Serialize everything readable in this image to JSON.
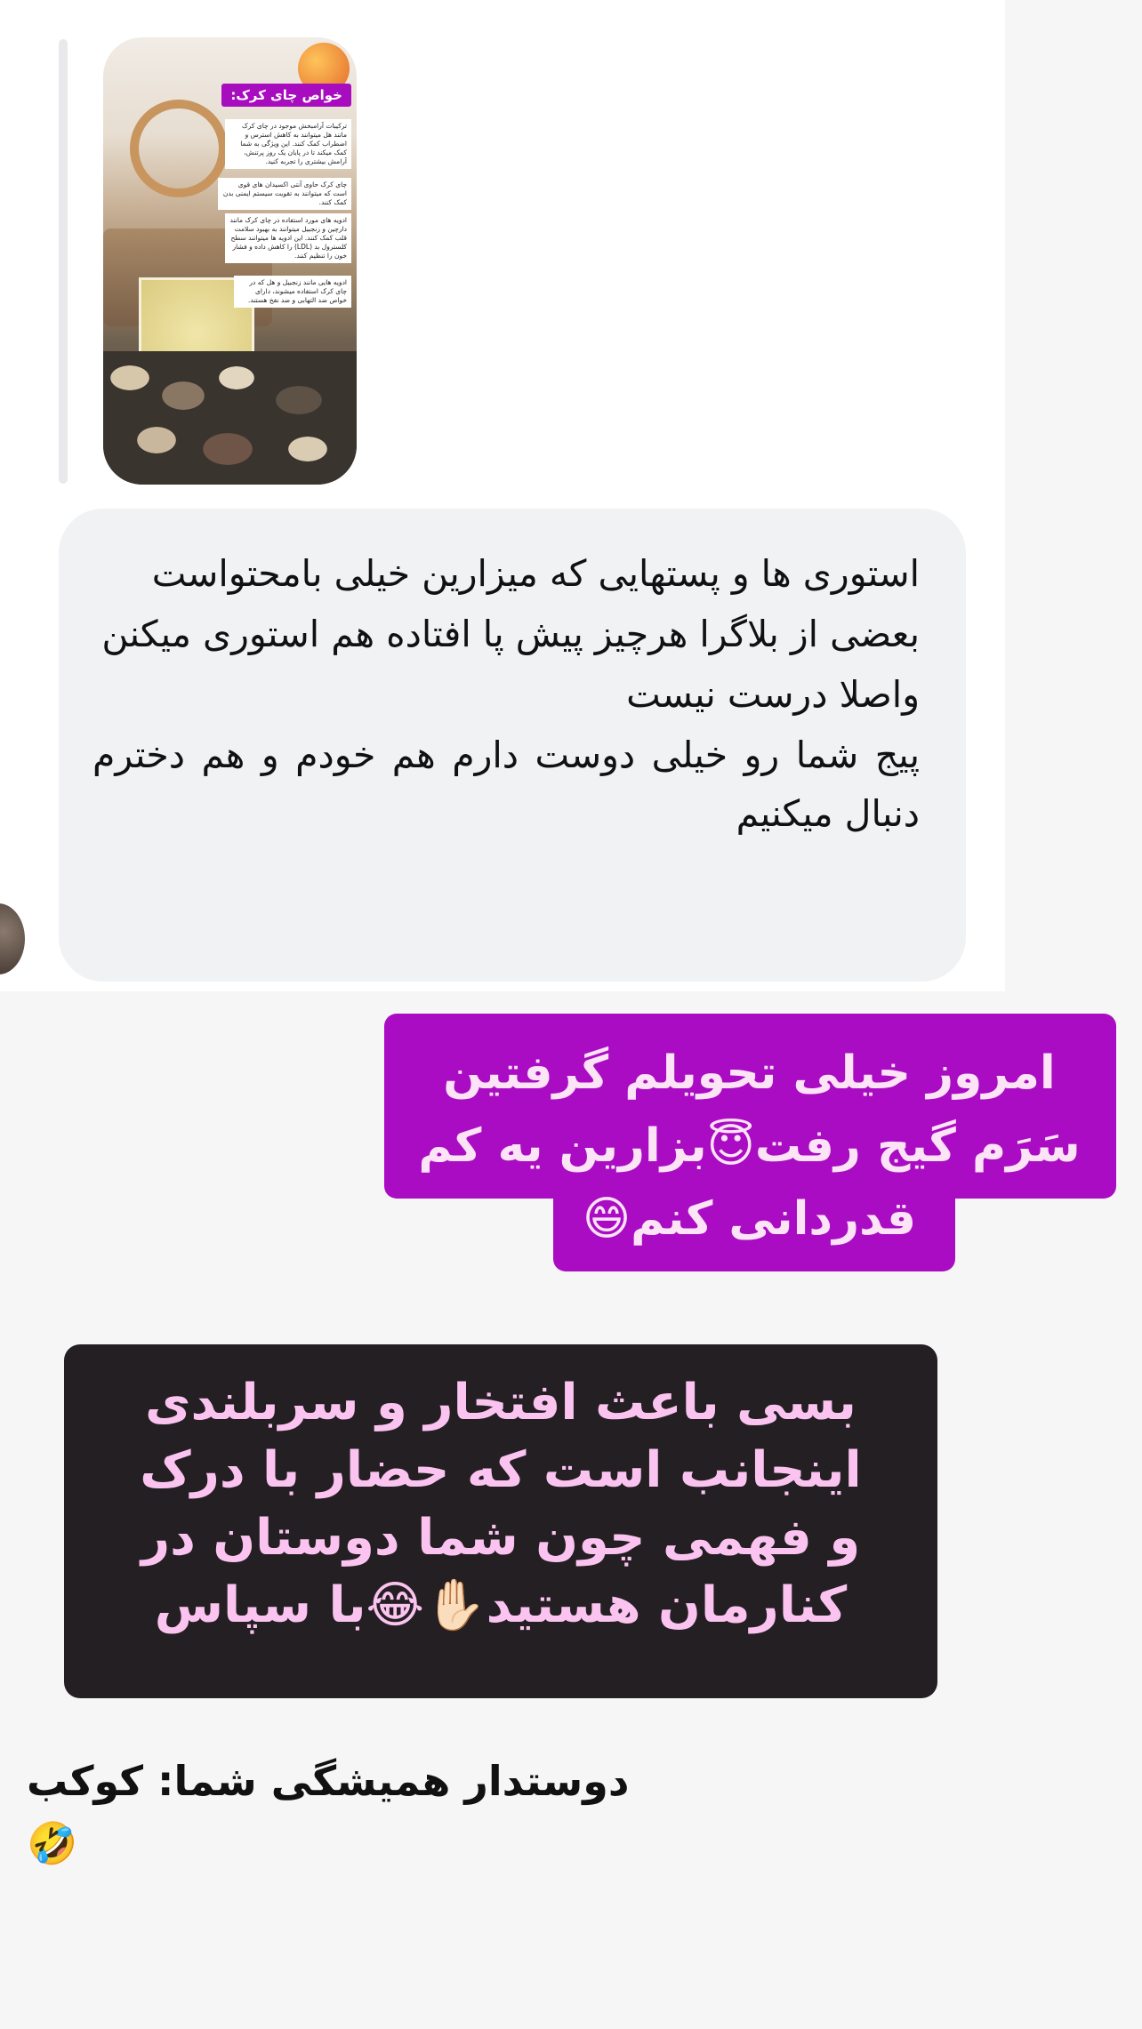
{
  "story_reply": {
    "title": "خواص چای کرک:",
    "notes": [
      "ترکیبات آرامبخش موجود در چای کرک مانند هل میتوانند به کاهش استرس و اضطراب کمک کنند. این ویژگی به شما کمک میکند تا در پایان یک روز پرتنش، آرامش بیشتری را تجربه کنید.",
      "چای کرک حاوی آنتی اکسیدان های قوی است که میتوانند به تقویت سیستم ایمنی بدن کمک کنند.",
      "ادویه های مورد استفاده در چای کرک مانند دارچین و زنجبیل میتوانند به بهبود سلامت قلب کمک کنند. این ادویه ها میتوانند سطح کلسترول بد (LDL) را کاهش داده و فشار خون را تنظیم کنند.",
      "ادویه هایی مانند زنجبیل و هل که در چای کرک استفاده میشوند، دارای خواص ضد التهابی و ضد نفخ هستند."
    ]
  },
  "message": {
    "lines": [
      "استوری ها و پستهایی که میزارین خیلی بامحتواست",
      "بعضی از بلاگرا هرچیز پیش پا افتاده هم استوری میکنن",
      "واصلا درست نیست",
      "پیج شما رو خیلی دوست دارم هم خودم و هم دخترم دنبال میکنیم"
    ]
  },
  "sticker_pink": {
    "line1": "امروز خیلی تحویلم گرفتین",
    "line2": "سَرَم گیج رفت😇بزارین یه کم",
    "line3": "قدردانی کنم😄"
  },
  "sticker_dark": {
    "line1": "بسی باعث افتخار و سربلندی",
    "line2": "اینجانب است که حضار با درک",
    "line3": "و فهمی چون شما دوستان در",
    "line4": "کنارمان هستید✋🏻😂با سپاس"
  },
  "signature": "دوستدار همیشگی شما: کوکب🤣",
  "colors": {
    "pink_band": "#a90cc3",
    "pink_text": "#fde3f6",
    "dark_band": "#231f22",
    "dark_text": "#fbc4f0",
    "bubble": "#f1f2f4"
  }
}
